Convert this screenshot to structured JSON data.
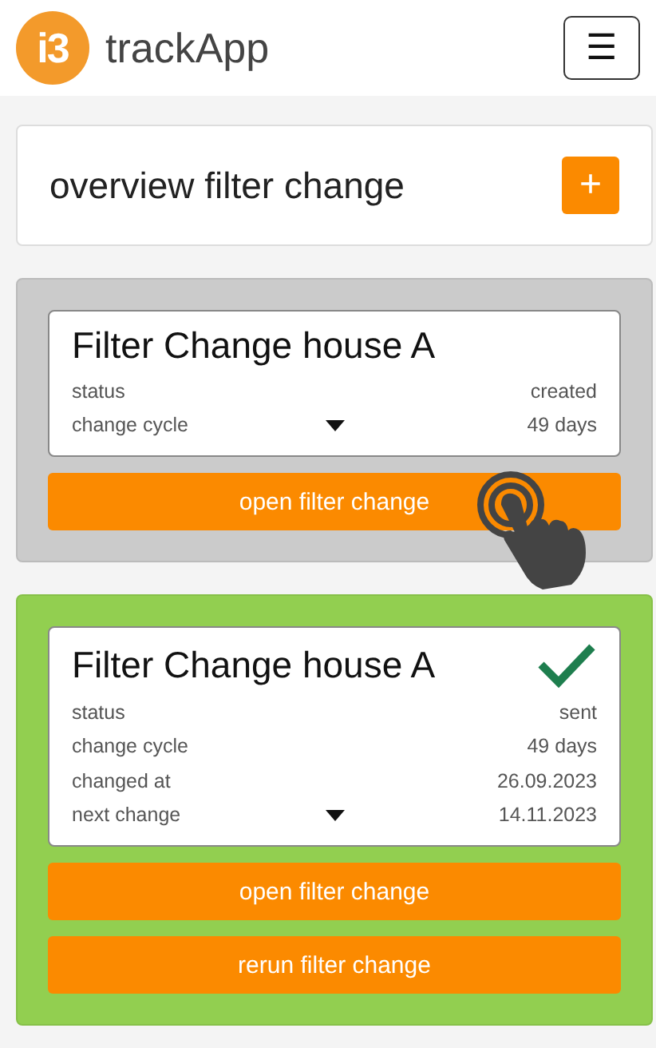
{
  "header": {
    "logo": "i3",
    "app_name": "trackApp",
    "menu_button": "☰"
  },
  "overview": {
    "title": "overview filter change",
    "add_button": "+"
  },
  "cards": [
    {
      "title": "Filter Change house A",
      "done": false,
      "fields": [
        {
          "label": "status",
          "value": "created"
        },
        {
          "label": "change cycle",
          "value": "49 days"
        }
      ],
      "buttons": [
        {
          "label": "open filter change",
          "tap_hint": true
        }
      ]
    },
    {
      "title": "Filter Change house A",
      "done": true,
      "fields": [
        {
          "label": "status",
          "value": "sent"
        },
        {
          "label": "change cycle",
          "value": "49 days"
        },
        {
          "label": "changed at",
          "value": "26.09.2023"
        },
        {
          "label": "next change",
          "value": "14.11.2023"
        }
      ],
      "buttons": [
        {
          "label": "open filter change",
          "tap_hint": false
        },
        {
          "label": "rerun filter change",
          "tap_hint": false
        }
      ]
    }
  ]
}
